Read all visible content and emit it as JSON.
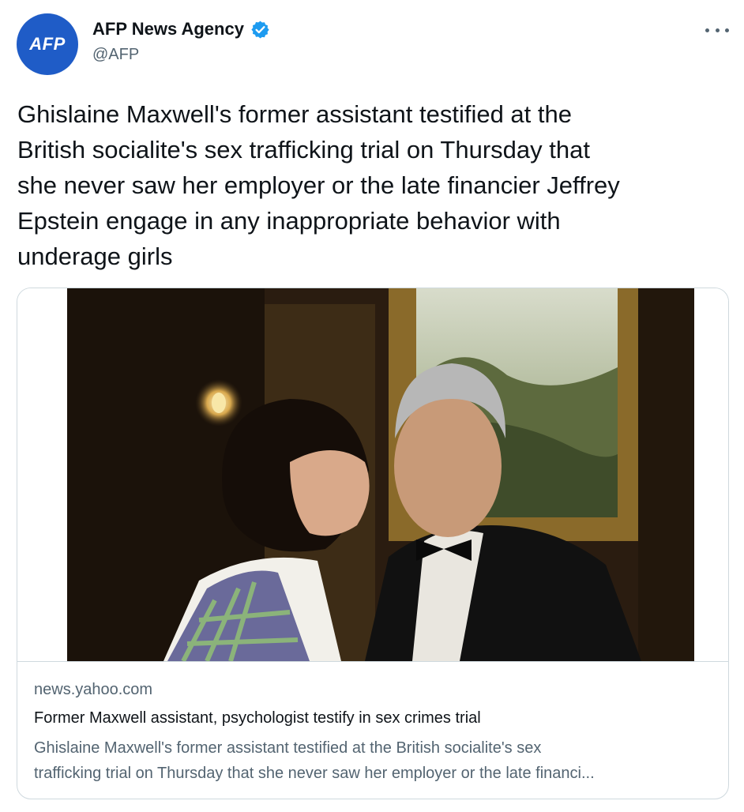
{
  "author": {
    "avatar_text": "AFP",
    "name": "AFP News Agency",
    "handle": "@AFP",
    "verified": true,
    "verified_color": "#1d9bf0",
    "avatar_color": "#1f5cc7"
  },
  "more_icon": "more-horizontal-icon",
  "tweet": {
    "text_lines": [
      "Ghislaine Maxwell's former assistant testified at the",
      "British socialite's sex trafficking trial on Thursday that",
      "she never saw her employer or the late financier Jeffrey",
      "Epstein engage in any inappropriate behavior with",
      "underage girls"
    ]
  },
  "link_card": {
    "domain": "news.yahoo.com",
    "title": "Former Maxwell assistant, psychologist testify in sex crimes trial",
    "description_lines": [
      "Ghislaine Maxwell's former assistant testified at the British socialite's sex",
      "trafficking trial on Thursday that she never saw her employer or the late financi..."
    ]
  }
}
